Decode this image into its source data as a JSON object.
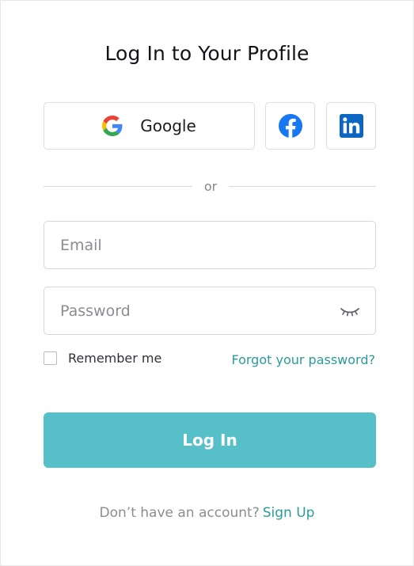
{
  "title": "Log In to Your Profile",
  "social": {
    "google_label": "Google",
    "facebook_icon": "facebook-icon",
    "linkedin_icon": "linkedin-icon"
  },
  "divider_text": "or",
  "email": {
    "placeholder": "Email",
    "value": ""
  },
  "password": {
    "placeholder": "Password",
    "value": "",
    "toggle_icon": "eye-closed-icon"
  },
  "remember_me": {
    "label": "Remember me",
    "checked": false
  },
  "forgot_password": "Forgot your password?",
  "login_button": "Log In",
  "signup": {
    "prompt": "Don’t have an account?",
    "link": "Sign Up"
  },
  "colors": {
    "accent": "#56bfc7",
    "link": "#2a9b9b",
    "facebook": "#1877f2",
    "linkedin": "#0a66c2"
  }
}
